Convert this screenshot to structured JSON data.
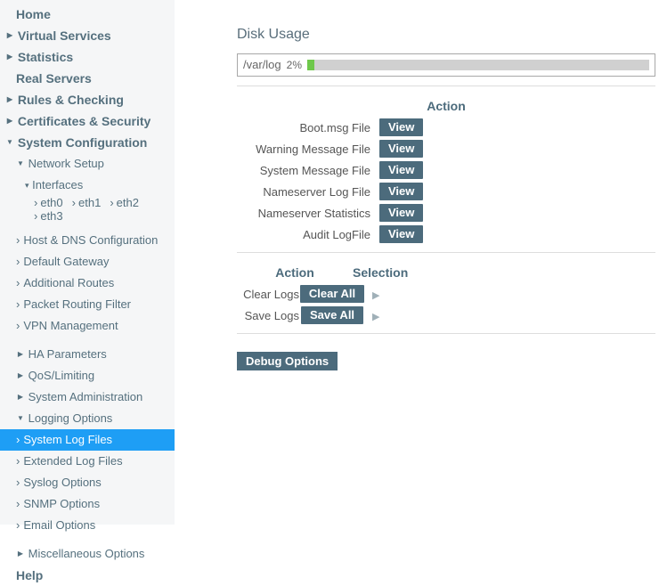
{
  "nav": {
    "home": "Home",
    "virtual": "Virtual Services",
    "stats": "Statistics",
    "real": "Real Servers",
    "rules": "Rules & Checking",
    "certs": "Certificates & Security",
    "sysconf": "System Configuration",
    "netsetup": "Network Setup",
    "interfaces": "Interfaces",
    "eth0": "eth0",
    "eth1": "eth1",
    "eth2": "eth2",
    "eth3": "eth3",
    "hostdns": "Host & DNS Configuration",
    "gateway": "Default Gateway",
    "routes": "Additional Routes",
    "filter": "Packet Routing Filter",
    "vpn": "VPN Management",
    "ha": "HA Parameters",
    "qos": "QoS/Limiting",
    "sysadmin": "System Administration",
    "logging": "Logging Options",
    "syslog": "System Log Files",
    "extlog": "Extended Log Files",
    "syslogopt": "Syslog Options",
    "snmp": "SNMP Options",
    "email": "Email Options",
    "misc": "Miscellaneous Options",
    "help": "Help"
  },
  "disk": {
    "title": "Disk Usage",
    "path": "/var/log",
    "pct": "2%",
    "fill_pct": 2
  },
  "logs": {
    "action_header": "Action",
    "items": [
      {
        "label": "Boot.msg File",
        "btn": "View"
      },
      {
        "label": "Warning Message File",
        "btn": "View"
      },
      {
        "label": "System Message File",
        "btn": "View"
      },
      {
        "label": "Nameserver Log File",
        "btn": "View"
      },
      {
        "label": "Nameserver Statistics",
        "btn": "View"
      },
      {
        "label": "Audit LogFile",
        "btn": "View"
      }
    ]
  },
  "bulk": {
    "action_header": "Action",
    "selection_header": "Selection",
    "clear_label": "Clear Logs",
    "clear_btn": "Clear All",
    "save_label": "Save Logs",
    "save_btn": "Save All"
  },
  "debug": {
    "btn": "Debug Options"
  }
}
